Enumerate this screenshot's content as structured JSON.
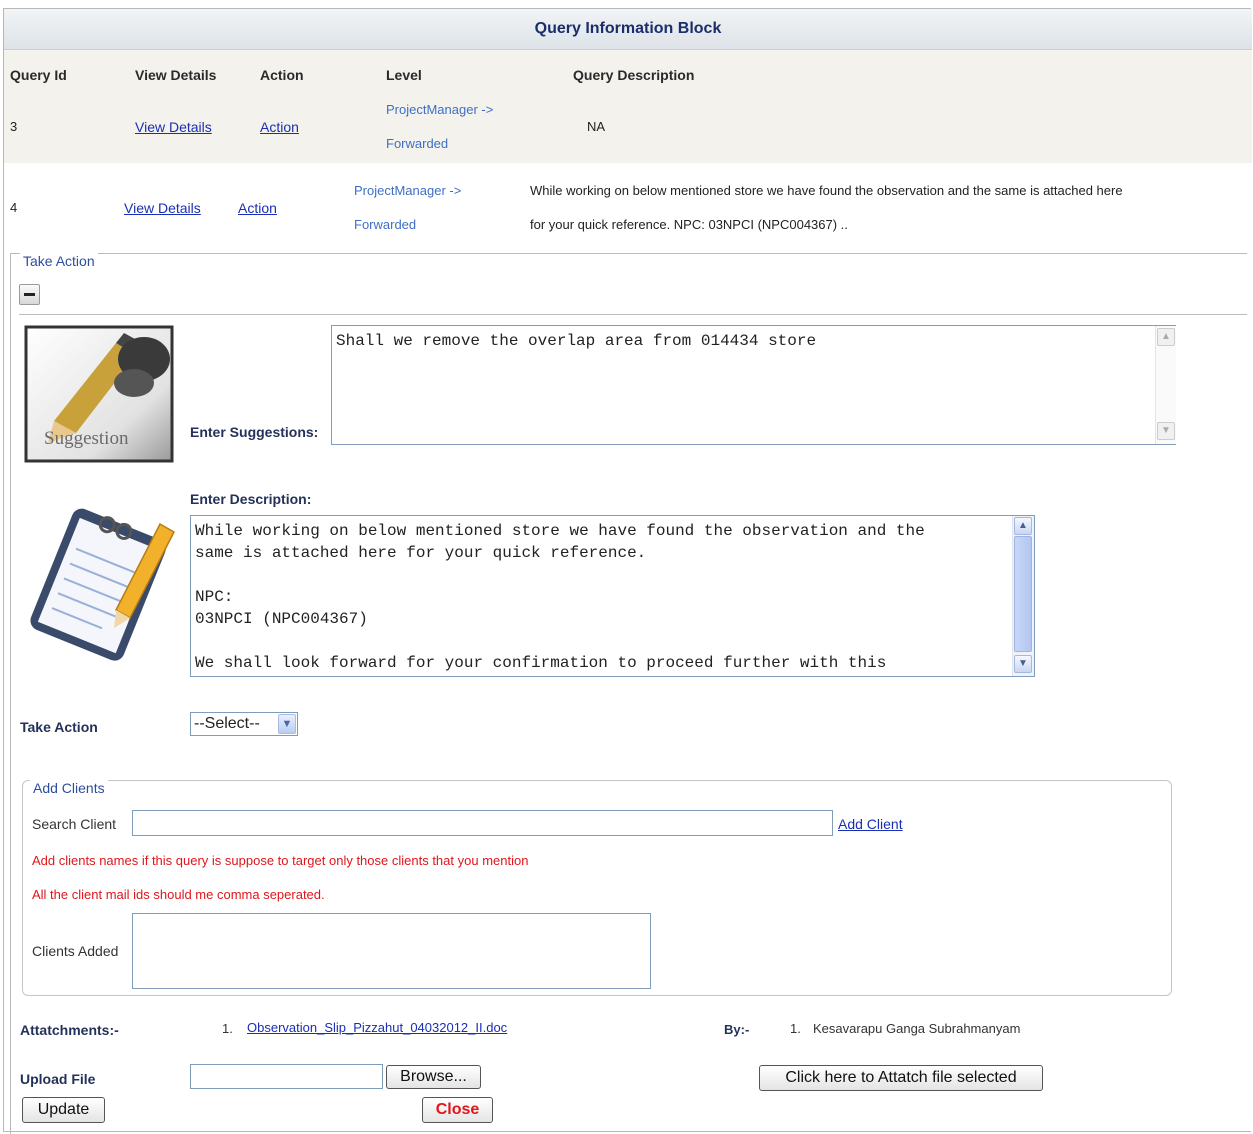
{
  "title": "Query Information Block",
  "table": {
    "headers": [
      "Query Id",
      "View Details",
      "Action",
      "Level",
      "Query Description"
    ],
    "rows": [
      {
        "id": "3",
        "view": "View Details",
        "action": "Action",
        "level_line1": "ProjectManager ->",
        "level_line2": "Forwarded",
        "description": "NA"
      },
      {
        "id": "4",
        "view": "View Details",
        "action": "Action",
        "level_line1": "ProjectManager ->",
        "level_line2": "Forwarded",
        "description_line1": "While working on below mentioned store we have found the observation and the same is attached here",
        "description_line2": "for your quick reference. NPC: 03NPCI (NPC004367) .."
      }
    ]
  },
  "take_action": {
    "legend": "Take Action",
    "suggestion_image_text": "Suggestion",
    "suggestions_label": "Enter Suggestions:",
    "suggestions_value": "Shall we remove the overlap area from 014434 store",
    "description_label": "Enter Description:",
    "description_value": "While working on below mentioned store we have found the observation and the\nsame is attached here for your quick reference.\n\nNPC:\n03NPCI (NPC004367)\n\nWe shall look forward for your confirmation to proceed further with this",
    "action_label": "Take Action",
    "action_select": "--Select--"
  },
  "clients": {
    "legend": "Add Clients",
    "search_label": "Search Client",
    "add_link": "Add Client",
    "note1": "Add clients names if this query is suppose to target only those clients that you mention",
    "note2": "All the client mail ids should me comma seperated.",
    "added_label": "Clients Added"
  },
  "attachments": {
    "label": "Attatchments:-",
    "num": "1.",
    "file": "Observation_Slip_Pizzahut_04032012_II.doc",
    "by_label": "By:-",
    "by_num": "1.",
    "by_name": "Kesavarapu Ganga Subrahmanyam"
  },
  "upload": {
    "label": "Upload File",
    "browse": "Browse...",
    "attach_button": "Click here to Attatch file selected",
    "update_button": "Update",
    "close_button": "Close"
  },
  "colors": {
    "header_bg": "#f3f2ec",
    "link": "#1a2fb5",
    "level": "#3f6fc4",
    "note_red": "#e0161c",
    "title": "#1b2e6a"
  }
}
